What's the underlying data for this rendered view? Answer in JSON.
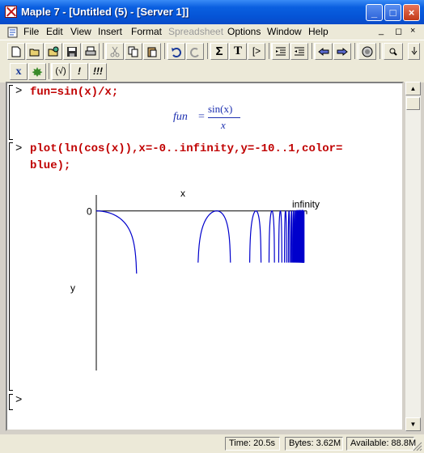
{
  "window": {
    "title": "Maple 7  - [Untitled (5) - [Server 1]]",
    "minimize": "_",
    "maximize": "□",
    "close": "×"
  },
  "menu": {
    "items": [
      "File",
      "Edit",
      "View",
      "Insert",
      "Format",
      "Spreadsheet",
      "Options",
      "Window",
      "Help"
    ],
    "disabled": [
      "Spreadsheet"
    ],
    "mdi_min": "_",
    "mdi_restore": "◻",
    "mdi_close": "×"
  },
  "toolbar": {
    "sigma": "Σ",
    "text": "T",
    "prompt": "[>",
    "eval_label": "(√)",
    "bang": "!",
    "bangs": "!!!",
    "x_toggle": "x"
  },
  "worksheet": {
    "cells": [
      {
        "prompt": ">",
        "input": "fun=sin(x)/x;"
      },
      {
        "prompt": ">",
        "input_lines": [
          "plot(ln(cos(x)),x=-0..infinity,y=-10..1,color=",
          "blue);"
        ]
      },
      {
        "prompt": ">"
      }
    ],
    "output_fun": "fun",
    "output_eq": "=",
    "output_num": "sin(x)",
    "output_den": "x"
  },
  "chart_data": {
    "type": "line",
    "function": "ln(cos(x))",
    "x_range": [
      "0",
      "infinity"
    ],
    "ylim": [
      -10,
      1
    ],
    "color": "#0000cc",
    "xlabel": "x",
    "ylabel": "y",
    "x_tick_labels": [
      "infinity"
    ],
    "y_tick_labels": [
      "0"
    ]
  },
  "status": {
    "time": "Time: 20.5s",
    "bytes": "Bytes: 3.62M",
    "available": "Available: 88.8M"
  }
}
